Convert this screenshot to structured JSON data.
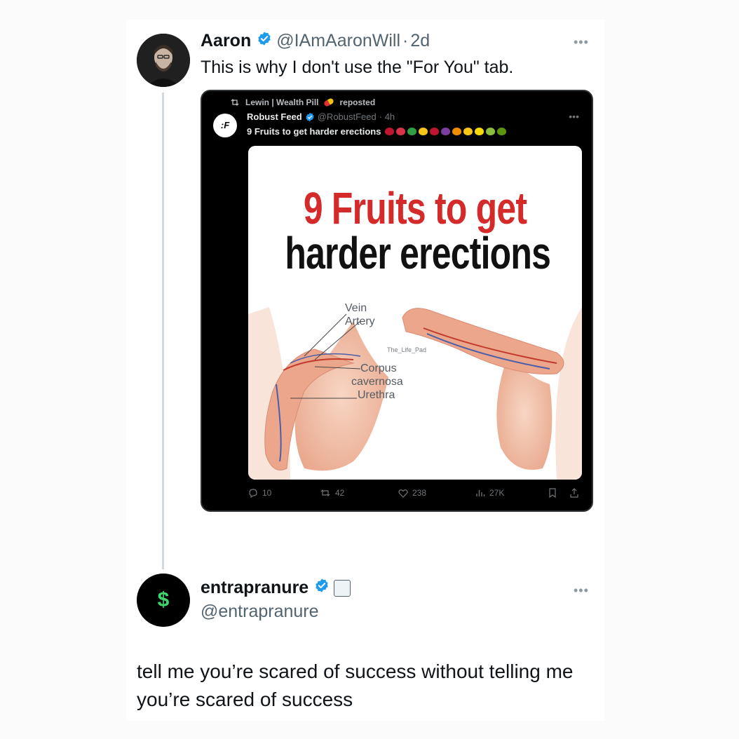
{
  "tweet": {
    "author_name": "Aaron",
    "author_handle": "@IAmAaronWill",
    "separator": "·",
    "timestamp": "2d",
    "text": "This is why I don't use the \"For You\" tab.",
    "more_icon": "more-horizontal-icon"
  },
  "embedded": {
    "repost_label": "Lewin | Wealth Pill",
    "repost_suffix": "reposted",
    "avatar_text": ":F",
    "author_name": "Robust Feed",
    "author_handle": "@RobustFeed",
    "timestamp": "· 4h",
    "text": "9 Fruits to get harder erections",
    "emoji_colors": [
      "#c0152f",
      "#d8334a",
      "#2f9e44",
      "#f5c518",
      "#c0152f",
      "#7b3fa0",
      "#f08c00",
      "#f5c518",
      "#f5d90a",
      "#8bbd3c",
      "#5c940d"
    ],
    "media": {
      "title_line1": "9 Fruits to get",
      "title_line2": "harder erections",
      "labels": {
        "vein": "Vein",
        "artery": "Artery",
        "corpus": "Corpus",
        "cavernosa": "cavernosa",
        "urethra": "Urethra",
        "watermark": "The_Life_Pad"
      }
    },
    "stats": {
      "replies": "10",
      "reposts": "42",
      "likes": "238",
      "views": "27K"
    }
  },
  "reply": {
    "avatar_symbol": "$",
    "author_name": "entrapranure",
    "author_handle": "@entrapranure",
    "text": "tell me you’re scared of success without telling me you’re scared of success"
  },
  "colors": {
    "verified": "#1d9bf0",
    "title_red": "#d42a2a",
    "avatar_green": "#3fd46c"
  }
}
